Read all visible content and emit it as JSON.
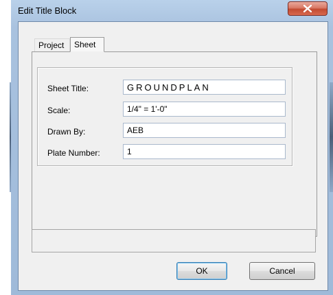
{
  "window": {
    "title": "Edit Title Block",
    "close_icon": "close-x-icon"
  },
  "tabs": [
    {
      "label": "Project",
      "active": false
    },
    {
      "label": "Sheet",
      "active": true
    }
  ],
  "fields": {
    "sheet_title": {
      "label": "Sheet Title:",
      "value": "GROUNDPLAN"
    },
    "scale": {
      "label": "Scale:",
      "value": "1/4\" = 1'-0\""
    },
    "drawn_by": {
      "label": "Drawn By:",
      "value": "AEB"
    },
    "plate_number": {
      "label": "Plate Number:",
      "value": "1"
    }
  },
  "status": {
    "text": ""
  },
  "buttons": {
    "ok": "OK",
    "cancel": "Cancel"
  },
  "colors": {
    "frame": "#a9c2df",
    "close_button": "#c24b32",
    "default_button_border": "#3c7fb1"
  }
}
